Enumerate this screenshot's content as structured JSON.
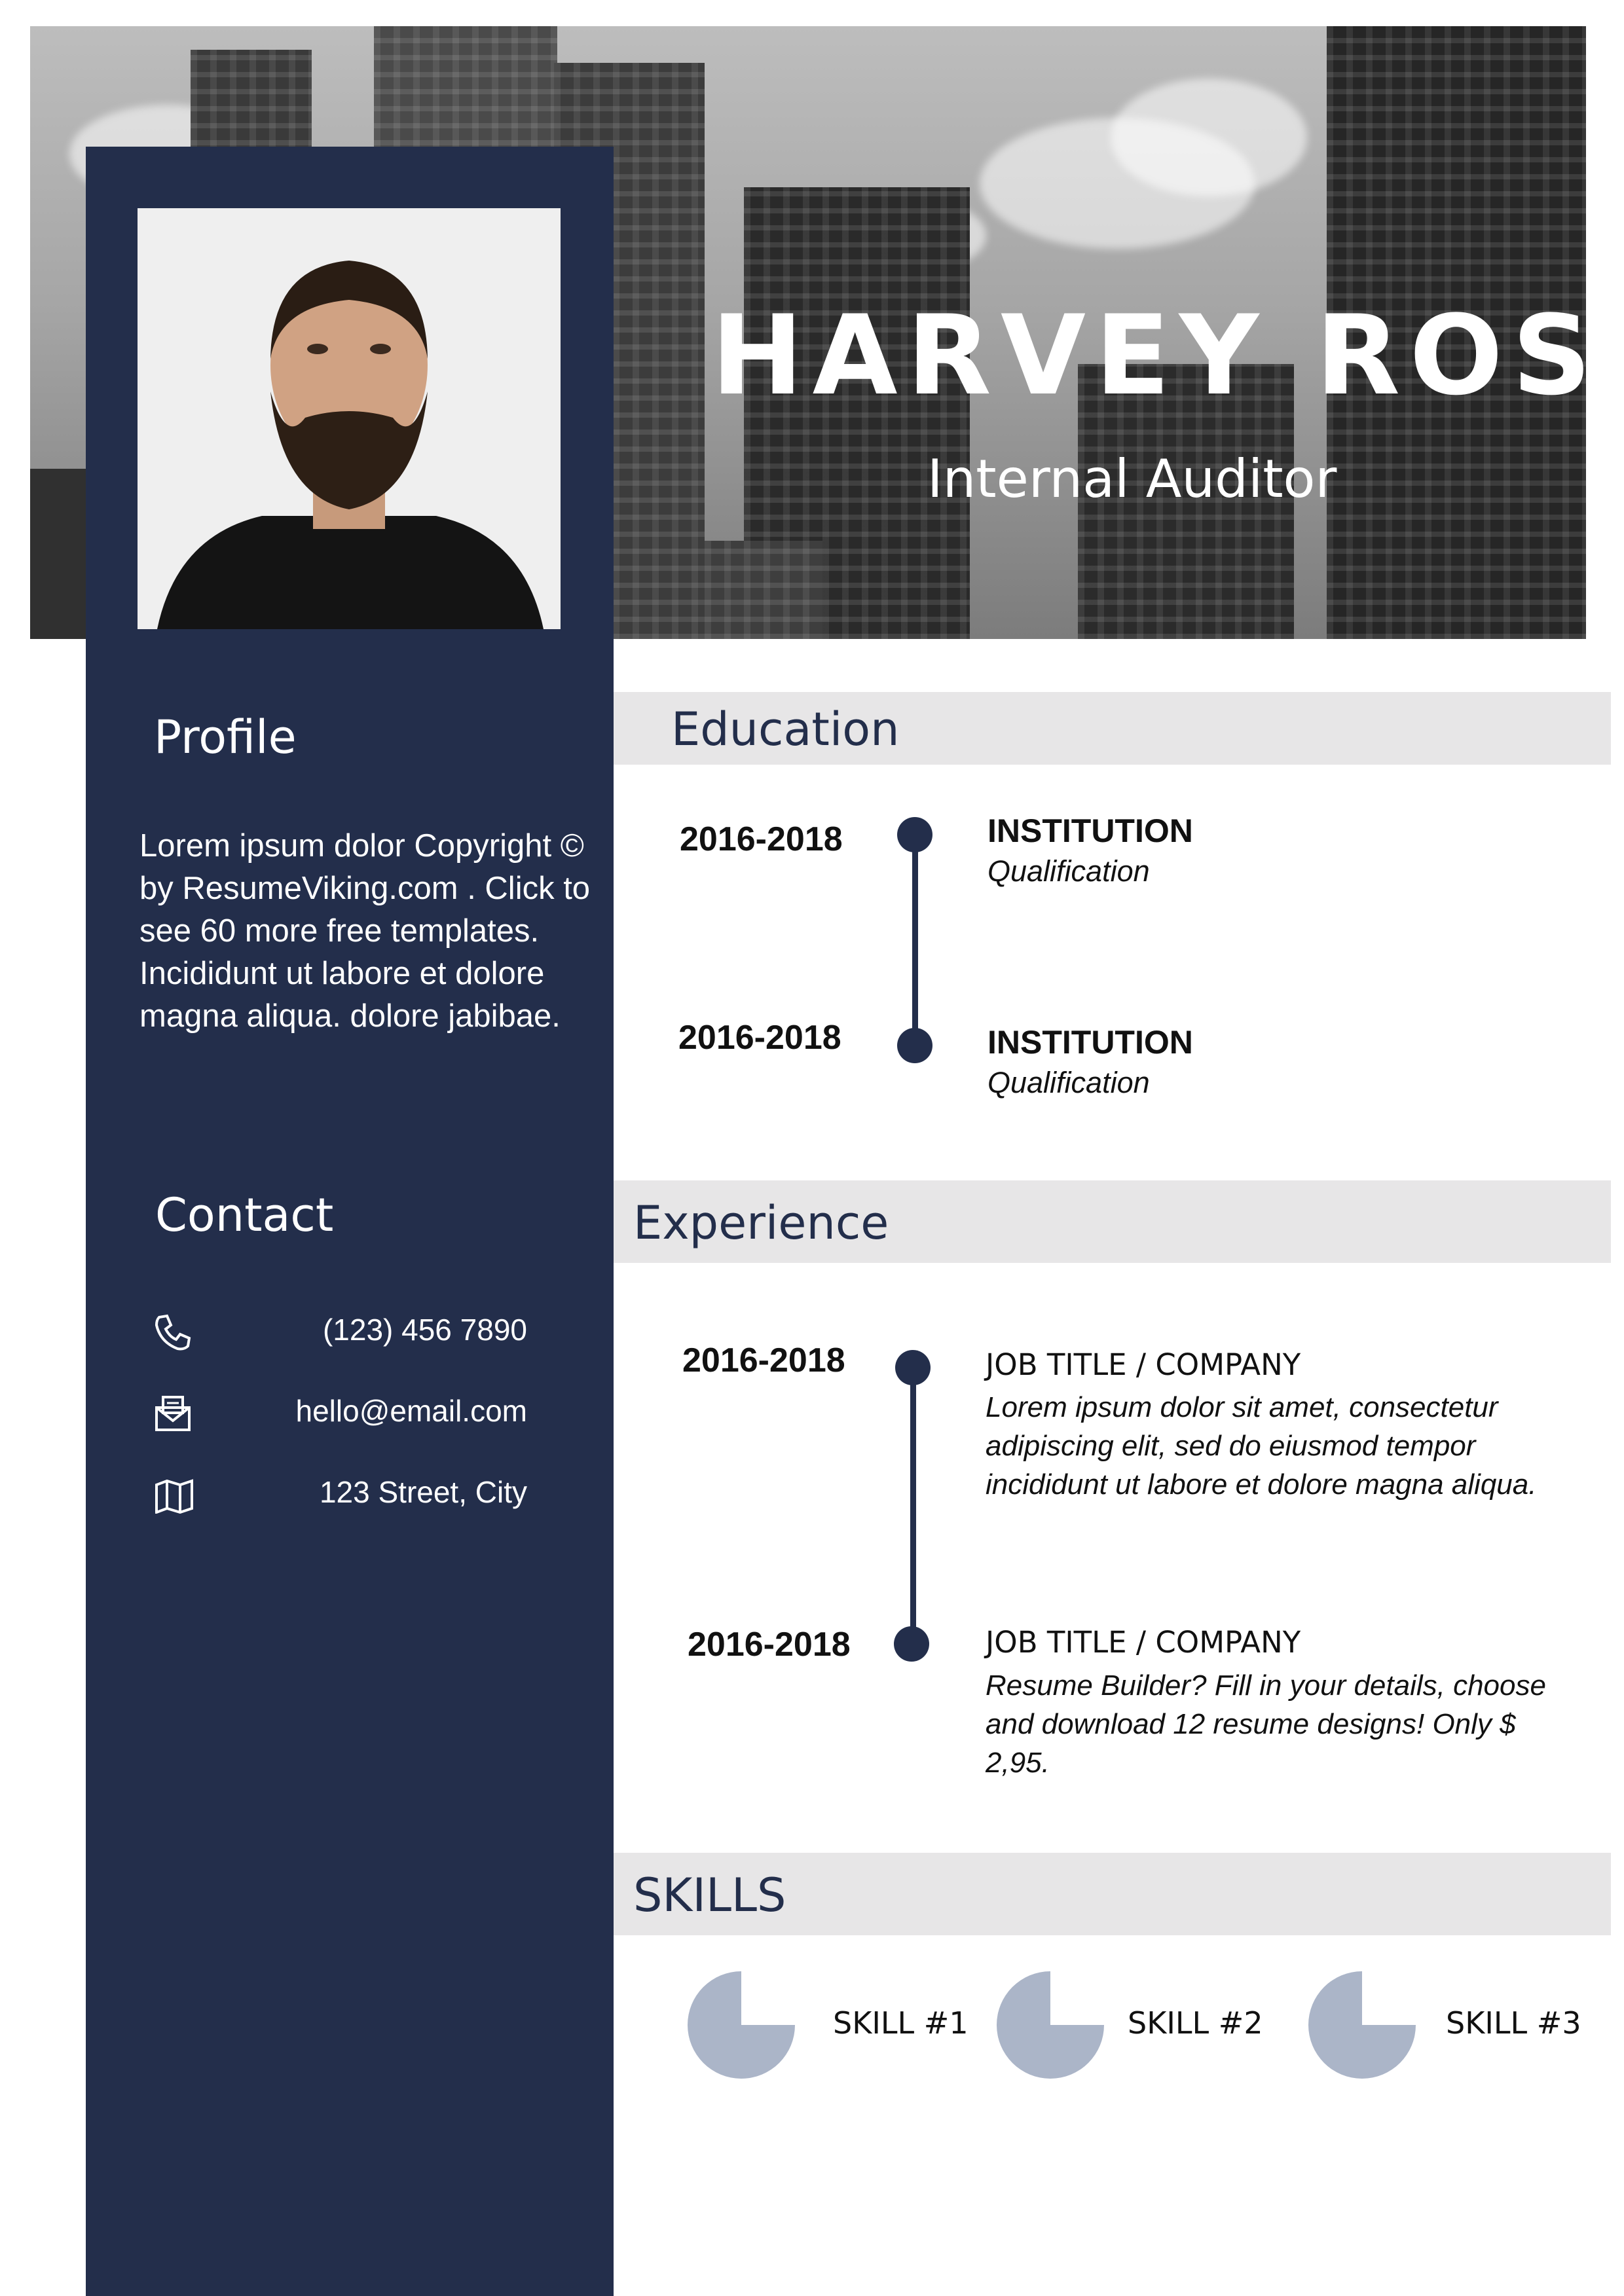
{
  "header": {
    "name": "HARVEY ROSS",
    "title": "Internal Auditor"
  },
  "sidebar": {
    "profile_heading": "Profile",
    "profile_text": "Lorem ipsum dolor Copyright © by ResumeViking.com . Click to see 60 more free templates. Incididunt ut labore et dolore magna aliqua. dolore jabibae.",
    "contact_heading": "Contact",
    "contacts": [
      {
        "icon": "phone-icon",
        "value": "(123) 456 7890"
      },
      {
        "icon": "mail-icon",
        "value": "hello@email.com"
      },
      {
        "icon": "map-icon",
        "value": "123 Street, City"
      }
    ]
  },
  "education": {
    "heading": "Education",
    "items": [
      {
        "years": "2016-2018",
        "institution": "INSTITUTION",
        "qualification": "Qualification"
      },
      {
        "years": "2016-2018",
        "institution": "INSTITUTION",
        "qualification": "Qualification"
      }
    ]
  },
  "experience": {
    "heading": "Experience",
    "items": [
      {
        "years": "2016-2018",
        "title": "JOB TITLE / COMPANY",
        "description": "Lorem ipsum dolor sit amet, consectetur adipiscing elit, sed do eiusmod tempor incididunt ut labore et dolore magna aliqua."
      },
      {
        "years": "2016-2018",
        "title": "JOB TITLE / COMPANY",
        "description": "Resume Builder? Fill in your details, choose and download 12 resume designs! Only $ 2,95."
      }
    ]
  },
  "skills": {
    "heading": "SKILLS",
    "items": [
      {
        "label": "SKILL #1",
        "level": 0.75
      },
      {
        "label": "SKILL #2",
        "level": 0.75
      },
      {
        "label": "SKILL #3",
        "level": 0.75
      }
    ]
  },
  "colors": {
    "navy": "#232e4b",
    "section_bg": "#e7e6e7",
    "skill_fill": "#abb5c8"
  }
}
